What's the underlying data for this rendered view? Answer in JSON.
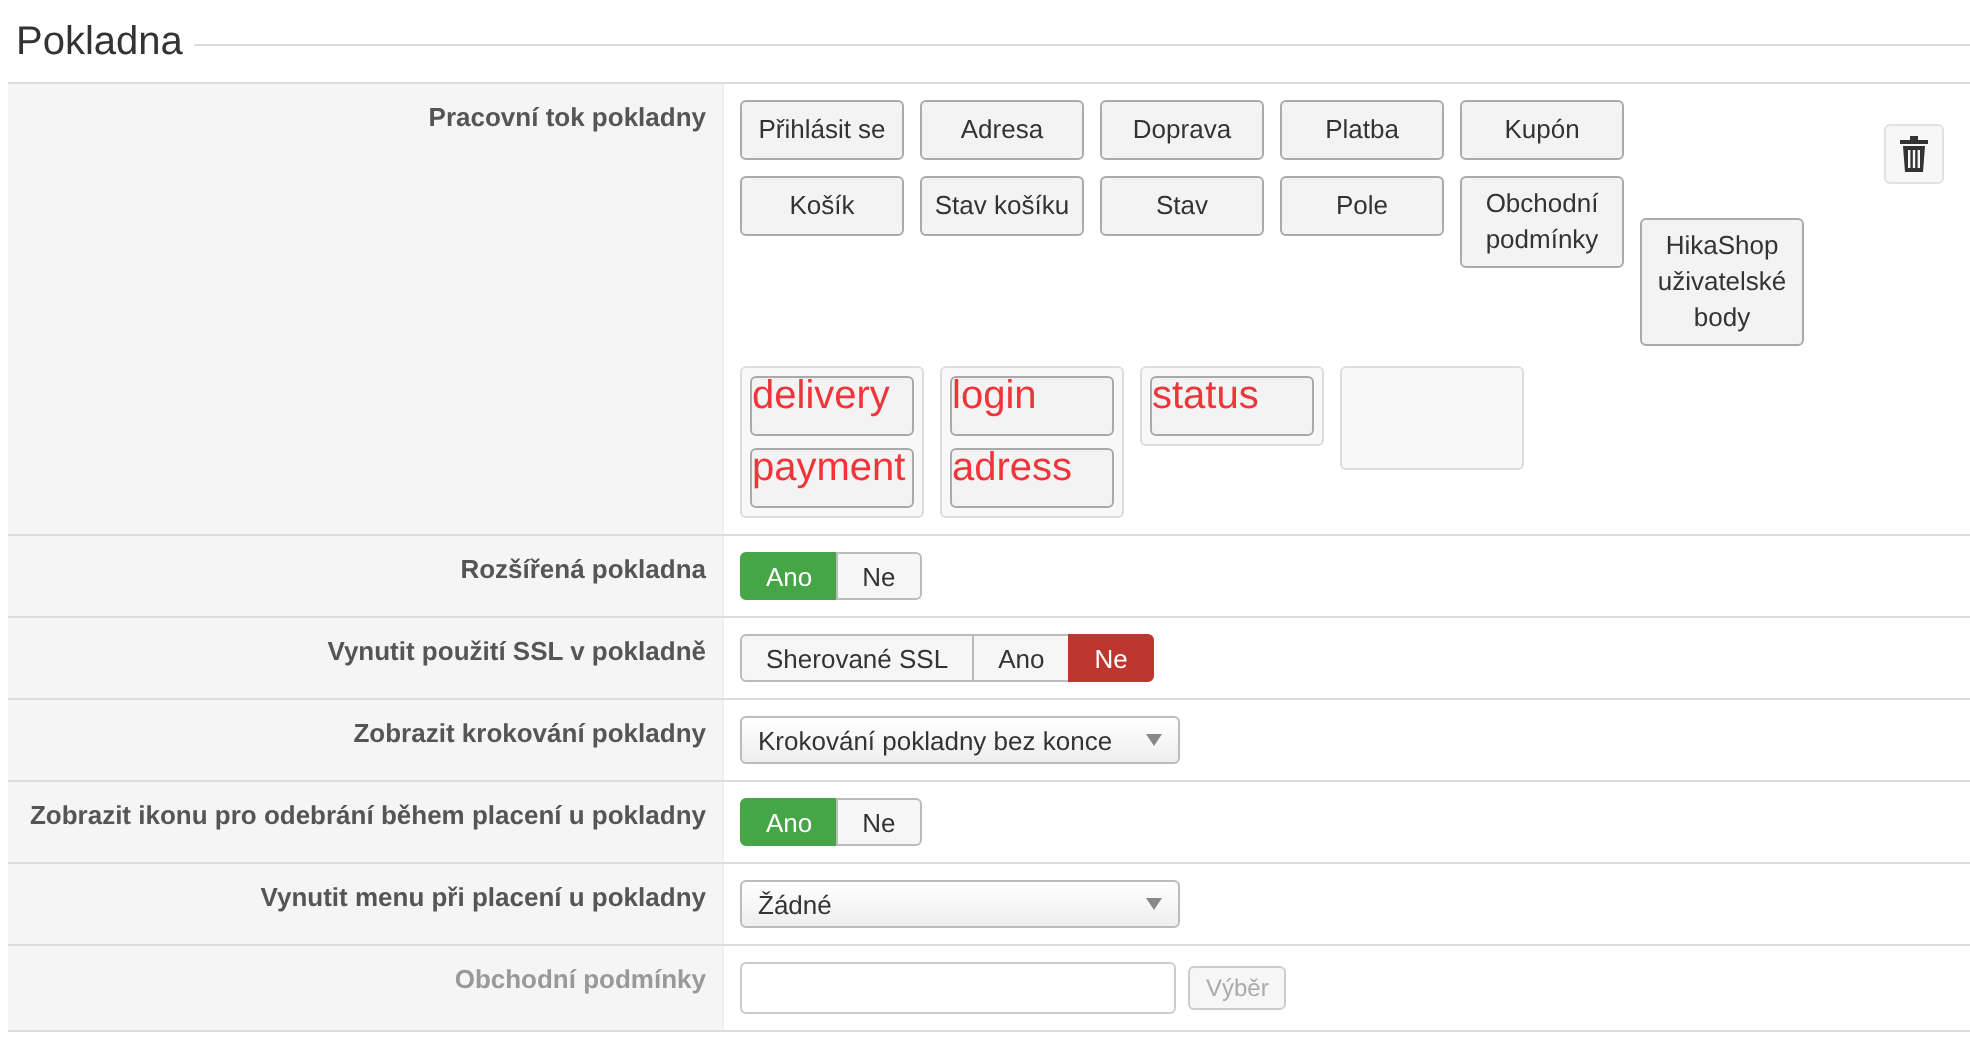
{
  "section": {
    "title": "Pokladna"
  },
  "rows": [
    {
      "kind": "workflow",
      "label": "Pracovní tok pokladny",
      "palette_rows": [
        [
          "Přihlásit se",
          "Adresa",
          "Doprava",
          "Platba",
          "Kupón"
        ],
        [
          "Košík",
          "Stav košíku",
          "Stav",
          "Pole",
          "Obchodní podmínky",
          "HikaShop uživatelské body"
        ]
      ],
      "steps": [
        {
          "kind": "filled",
          "items": [
            {
              "annotation": "delivery"
            },
            {
              "annotation": "payment"
            }
          ]
        },
        {
          "kind": "filled",
          "items": [
            {
              "annotation": "login"
            },
            {
              "annotation": "adress"
            }
          ]
        },
        {
          "kind": "filled",
          "items": [
            {
              "annotation": "status"
            }
          ]
        },
        {
          "kind": "empty"
        }
      ]
    },
    {
      "kind": "toggle",
      "label": "Rozšířená pokladna",
      "options": [
        {
          "label": "Ano",
          "selected": true,
          "color": "#46a546"
        },
        {
          "label": "Ne",
          "selected": false
        }
      ]
    },
    {
      "kind": "toggle",
      "label": "Vynutit použití SSL v pokladně",
      "options": [
        {
          "label": "Sherované SSL",
          "selected": false
        },
        {
          "label": "Ano",
          "selected": false
        },
        {
          "label": "Ne",
          "selected": true,
          "color": "#bd362f"
        }
      ]
    },
    {
      "kind": "select",
      "label": "Zobrazit krokování pokladny",
      "value": "Krokování pokladny bez konce"
    },
    {
      "kind": "toggle",
      "label": "Zobrazit ikonu pro odebrání během placení u pokladny",
      "options": [
        {
          "label": "Ano",
          "selected": true,
          "color": "#46a546"
        },
        {
          "label": "Ne",
          "selected": false
        }
      ]
    },
    {
      "kind": "select",
      "label": "Vynutit menu při placení u pokladny",
      "value": "Žádné"
    },
    {
      "kind": "picker",
      "label": "Obchodní podmínky",
      "button": "Výběr"
    }
  ]
}
